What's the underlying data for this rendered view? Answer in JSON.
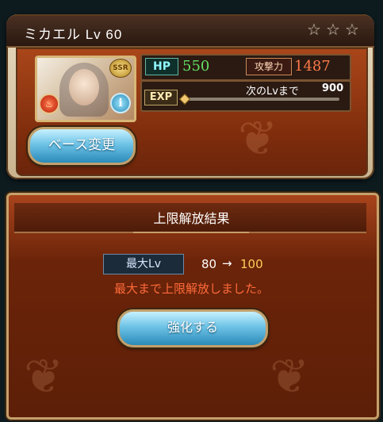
{
  "character": {
    "name_title": "ミカエル Lv 60",
    "stars": [
      "☆",
      "☆",
      "☆"
    ],
    "rarity_badge": "SSR",
    "hp_label": "HP",
    "hp_value": "550",
    "atk_label": "攻撃力",
    "atk_value": "1487",
    "exp_label": "EXP",
    "next_lv_label": "次のLvまで",
    "next_lv_value": "900",
    "exp_progress_fraction": 0
  },
  "buttons": {
    "base_change": "ベース変更",
    "enhance": "強化する"
  },
  "result": {
    "title": "上限解放結果",
    "max_lv_label": "最大Lv",
    "old_lv": "80",
    "arrow": "→",
    "new_lv": "100",
    "message": "最大まで上限解放しました。"
  },
  "icons": {
    "element": "fire-element-icon",
    "info": "info-icon"
  }
}
